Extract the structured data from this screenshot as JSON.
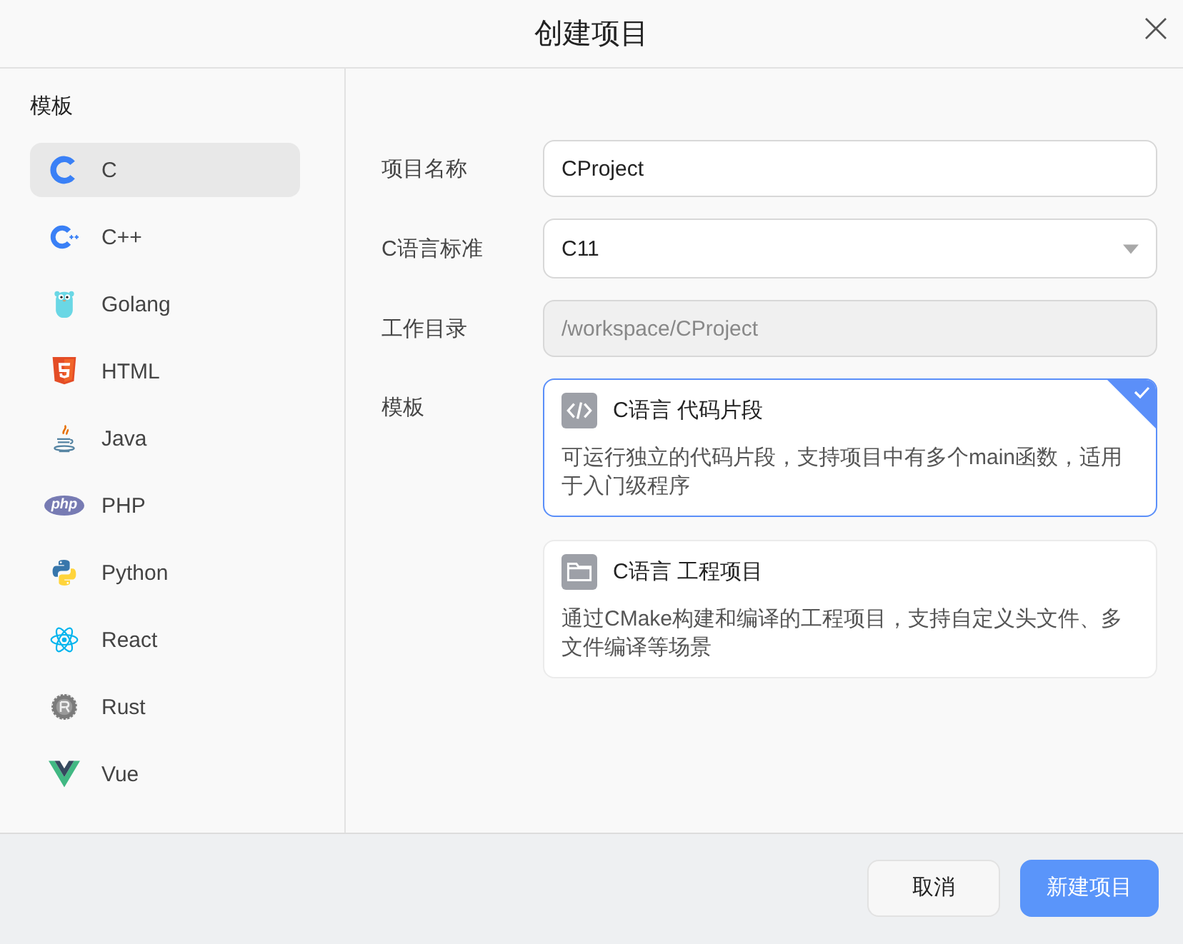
{
  "dialog": {
    "title": "创建项目"
  },
  "sidebar": {
    "heading": "模板",
    "items": [
      {
        "kind": "c",
        "label": "C",
        "selected": true
      },
      {
        "kind": "cpp",
        "label": "C++",
        "selected": false
      },
      {
        "kind": "golang",
        "label": "Golang",
        "selected": false
      },
      {
        "kind": "html",
        "label": "HTML",
        "selected": false
      },
      {
        "kind": "java",
        "label": "Java",
        "selected": false
      },
      {
        "kind": "php",
        "label": "PHP",
        "selected": false,
        "logo_text": "php"
      },
      {
        "kind": "python",
        "label": "Python",
        "selected": false
      },
      {
        "kind": "react",
        "label": "React",
        "selected": false
      },
      {
        "kind": "rust",
        "label": "Rust",
        "selected": false
      },
      {
        "kind": "vue",
        "label": "Vue",
        "selected": false
      }
    ]
  },
  "form": {
    "fields": [
      {
        "kind": "text",
        "label": "项目名称",
        "value": "CProject",
        "disabled": false
      },
      {
        "kind": "select",
        "label": "C语言标准",
        "value": "C11",
        "disabled": false
      },
      {
        "kind": "text",
        "label": "工作目录",
        "value": "/workspace/CProject",
        "disabled": true
      }
    ],
    "template_label": "模板",
    "templates": [
      {
        "kind": "snippet",
        "title": "C语言 代码片段",
        "description": "可运行独立的代码片段，支持项目中有多个main函数，适用于入门级程序",
        "selected": true
      },
      {
        "kind": "project",
        "title": "C语言 工程项目",
        "description": "通过CMake构建和编译的工程项目，支持自定义头文件、多文件编译等场景",
        "selected": false
      }
    ]
  },
  "footer": {
    "buttons": [
      {
        "kind": "secondary",
        "label": "取消"
      },
      {
        "kind": "primary",
        "label": "新建项目"
      }
    ]
  }
}
